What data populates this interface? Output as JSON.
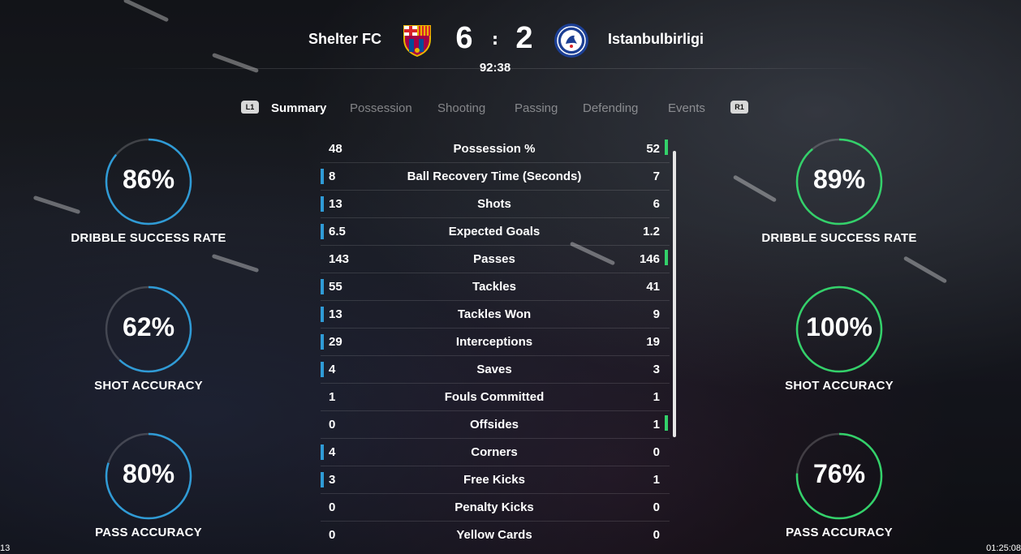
{
  "match": {
    "home_team": "Shelter FC",
    "away_team": "Istanbulbirligi",
    "home_score": "6",
    "away_score": "2",
    "score_separator": ":",
    "clock": "92:38",
    "home_color": "#2f9bd6",
    "away_color": "#33d16a"
  },
  "tabs": {
    "left_bumper": "L1",
    "right_bumper": "R1",
    "items": [
      "Summary",
      "Possession",
      "Shooting",
      "Passing",
      "Defending",
      "Events"
    ],
    "active": "Summary"
  },
  "home_rings": [
    {
      "value": "86%",
      "fraction": 0.86,
      "label": "DRIBBLE SUCCESS RATE"
    },
    {
      "value": "62%",
      "fraction": 0.62,
      "label": "SHOT ACCURACY"
    },
    {
      "value": "80%",
      "fraction": 0.8,
      "label": "PASS ACCURACY"
    }
  ],
  "away_rings": [
    {
      "value": "89%",
      "fraction": 0.89,
      "label": "DRIBBLE SUCCESS RATE"
    },
    {
      "value": "100%",
      "fraction": 1.0,
      "label": "SHOT ACCURACY"
    },
    {
      "value": "76%",
      "fraction": 0.76,
      "label": "PASS ACCURACY"
    }
  ],
  "stats": [
    {
      "name": "Possession %",
      "home": "48",
      "away": "52",
      "leader": "away"
    },
    {
      "name": "Ball Recovery Time (Seconds)",
      "home": "8",
      "away": "7",
      "leader": "home"
    },
    {
      "name": "Shots",
      "home": "13",
      "away": "6",
      "leader": "home"
    },
    {
      "name": "Expected Goals",
      "home": "6.5",
      "away": "1.2",
      "leader": "home"
    },
    {
      "name": "Passes",
      "home": "143",
      "away": "146",
      "leader": "away"
    },
    {
      "name": "Tackles",
      "home": "55",
      "away": "41",
      "leader": "home"
    },
    {
      "name": "Tackles Won",
      "home": "13",
      "away": "9",
      "leader": "home"
    },
    {
      "name": "Interceptions",
      "home": "29",
      "away": "19",
      "leader": "home"
    },
    {
      "name": "Saves",
      "home": "4",
      "away": "3",
      "leader": "home"
    },
    {
      "name": "Fouls Committed",
      "home": "1",
      "away": "1",
      "leader": "none"
    },
    {
      "name": "Offsides",
      "home": "0",
      "away": "1",
      "leader": "away"
    },
    {
      "name": "Corners",
      "home": "4",
      "away": "0",
      "leader": "home"
    },
    {
      "name": "Free Kicks",
      "home": "3",
      "away": "1",
      "leader": "home"
    },
    {
      "name": "Penalty Kicks",
      "home": "0",
      "away": "0",
      "leader": "none"
    },
    {
      "name": "Yellow Cards",
      "home": "0",
      "away": "0",
      "leader": "none"
    }
  ],
  "corner": {
    "left": "13",
    "right": "01:25:08"
  }
}
